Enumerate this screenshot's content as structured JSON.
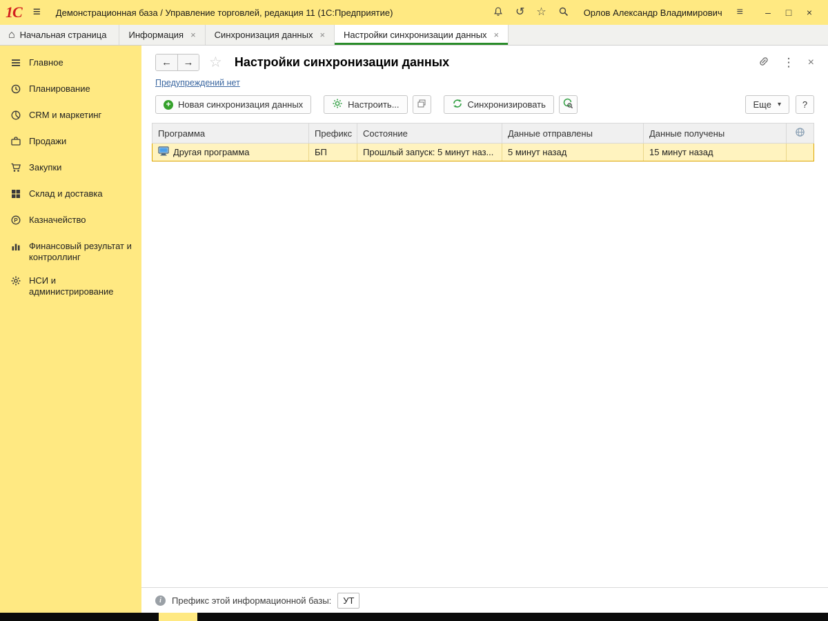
{
  "titlebar": {
    "logo": "1С",
    "title": "Демонстрационная база / Управление торговлей, редакция 11  (1С:Предприятие)",
    "user": "Орлов Александр Владимирович"
  },
  "tabbar": {
    "home_label": "Начальная страница",
    "tabs": [
      {
        "label": "Информация"
      },
      {
        "label": "Синхронизация данных"
      },
      {
        "label": "Настройки синхронизации данных"
      }
    ]
  },
  "sidebar": {
    "items": [
      {
        "label": "Главное"
      },
      {
        "label": "Планирование"
      },
      {
        "label": "CRM и маркетинг"
      },
      {
        "label": "Продажи"
      },
      {
        "label": "Закупки"
      },
      {
        "label": "Склад и доставка"
      },
      {
        "label": "Казначейство"
      },
      {
        "label": "Финансовый результат и контроллинг"
      },
      {
        "label": "НСИ и администрирование"
      }
    ]
  },
  "content": {
    "page_title": "Настройки синхронизации данных",
    "warnings_link": "Предупреждений нет",
    "toolbar": {
      "new_sync_label": "Новая синхронизация данных",
      "configure_label": "Настроить...",
      "sync_label": "Синхронизировать",
      "more_label": "Еще",
      "help_label": "?"
    },
    "table": {
      "headers": [
        "Программа",
        "Префикс",
        "Состояние",
        "Данные отправлены",
        "Данные получены"
      ],
      "rows": [
        {
          "program": "Другая программа",
          "prefix": "БП",
          "state": "Прошлый запуск: 5 минут наз...",
          "sent": "5 минут назад",
          "received": "15 минут назад"
        }
      ]
    },
    "statusbar": {
      "prefix_label": "Префикс этой информационной базы:",
      "prefix_value": "УТ"
    }
  },
  "icons": {
    "hamburger": "≡",
    "history": "↺",
    "favorites_star": "☆",
    "home": "⌂",
    "tab_close": "×",
    "back": "←",
    "forward": "→",
    "page_star": "☆",
    "kebab": "⋮",
    "close": "×",
    "minimize": "–",
    "maximize": "□",
    "window_close": "×",
    "more_arrow": "▾",
    "plus": "+",
    "info": "i",
    "colors": {
      "accent_yellow": "#ffe982",
      "active_tab_green": "#2a8c2a",
      "selection_orange": "#dda500",
      "link_blue": "#3a66a0"
    }
  }
}
